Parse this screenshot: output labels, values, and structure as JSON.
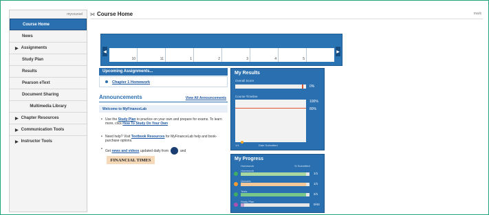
{
  "header": {
    "title": "Course Home",
    "right_text": "mark"
  },
  "nav": {
    "top_link": "mycoursel",
    "items": [
      {
        "label": "Course Home",
        "active": true,
        "expandable": false
      },
      {
        "label": "News",
        "active": false,
        "expandable": false
      },
      {
        "label": "Assignments",
        "active": false,
        "expandable": true
      },
      {
        "label": "Study Plan",
        "active": false,
        "expandable": false
      },
      {
        "label": "Results",
        "active": false,
        "expandable": false
      },
      {
        "label": "Pearson eText",
        "active": false,
        "expandable": false
      },
      {
        "label": "Document Sharing",
        "active": false,
        "expandable": false
      },
      {
        "label": "Multimedia Library",
        "active": false,
        "expandable": false
      },
      {
        "label": "Chapter Resources",
        "active": false,
        "expandable": true
      },
      {
        "label": "Communication Tools",
        "active": false,
        "expandable": true
      },
      {
        "label": "Instructor Tools",
        "active": false,
        "expandable": true
      }
    ]
  },
  "calendar": {
    "days": [
      "10",
      "11",
      "1",
      "2",
      "3",
      "4",
      "5",
      ""
    ]
  },
  "upcoming": {
    "title": "Upcoming Assignments...",
    "item": "Chapter 1 Homework"
  },
  "announcements": {
    "title": "Announcements",
    "view_all": "View All Announcements",
    "welcome": "Welcome to MyFinanceLab",
    "bullet1_pre": "Use the ",
    "bullet1_link": "Study Plan",
    "bullet1_mid": " to practice on your own and prepare for exams. To learn more, click ",
    "bullet1_link2": "How To Study On Your Own",
    "bullet2_pre": "Need help? Visit ",
    "bullet2_link": "Textbook Resources",
    "bullet2_post": " for MyFinanceLab help and book-purchase options.",
    "bullet3_pre": "Get ",
    "bullet3_link": "news and videos",
    "bullet3_post": " updated daily from",
    "bullet3_tail": "and",
    "ft_label": "FINANCIAL TIMES"
  },
  "results": {
    "title": "My Results",
    "overall_label": "Overall Score",
    "overall_pct": "0%",
    "timeline_label": "Course Timeline",
    "timeline_top": "100%",
    "timeline_mid": "80%",
    "foot_left": "1/1",
    "foot_mid": "Date Submitted"
  },
  "progress": {
    "title": "My Progress",
    "col_left": "Homework",
    "col_right": "% Submitted",
    "rows": [
      {
        "name": "Homework",
        "value": "1/1",
        "color": "#3fae63",
        "fill": 0.95,
        "fill_color": "#a8d8a0"
      },
      {
        "name": "Quizzes",
        "value": "1/1",
        "color": "#f39c34",
        "fill": 0.95,
        "fill_color": "#f5c89a"
      },
      {
        "name": "Tests",
        "value": "2/1",
        "color": "#3fae63",
        "fill": 0.95,
        "fill_color": "#78c88a"
      },
      {
        "name": "Study Plan",
        "value": "0/44",
        "color": "#b04fb0",
        "fill": 0.05,
        "fill_color": "#c9a0d0"
      }
    ]
  }
}
